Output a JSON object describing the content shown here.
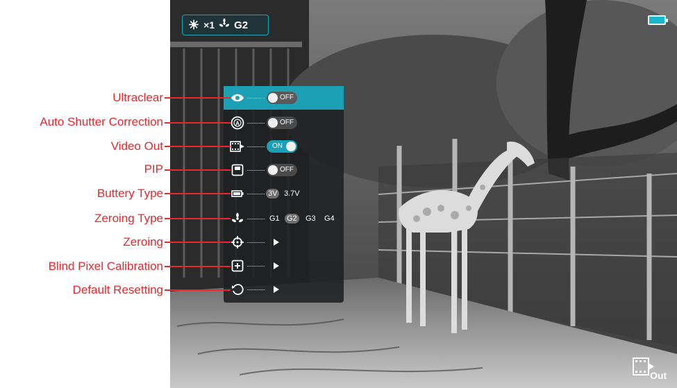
{
  "callouts": [
    {
      "label": "Ultraclear"
    },
    {
      "label": "Auto Shutter Correction"
    },
    {
      "label": "Video Out"
    },
    {
      "label": "PIP"
    },
    {
      "label": "Buttery Type"
    },
    {
      "label": "Zeroing Type"
    },
    {
      "label": "Zeroing"
    },
    {
      "label": "Blind Pixel Calibration"
    },
    {
      "label": "Default Resetting"
    }
  ],
  "status": {
    "brightness_icon": "sun-icon",
    "zoom": "×1",
    "zeroing_icon": "zeroing-fan-icon",
    "zeroing_value": "G2"
  },
  "battery": {
    "icon": "battery-icon",
    "level": 1.0,
    "color": "#18b7c9"
  },
  "menu": {
    "ultraclear": {
      "icon": "eye-icon",
      "state": "OFF"
    },
    "auto_shutter": {
      "icon": "auto-shutter-icon",
      "state": "OFF"
    },
    "video_out": {
      "icon": "video-out-icon",
      "state": "ON"
    },
    "pip": {
      "icon": "pip-icon",
      "state": "OFF"
    },
    "battery_type": {
      "icon": "battery-small-icon",
      "options": [
        "3V",
        "3.7V"
      ],
      "selected": "3V"
    },
    "zeroing_type": {
      "icon": "zeroing-fan-icon",
      "options": [
        "G1",
        "G2",
        "G3",
        "G4"
      ],
      "selected": "G2"
    },
    "zeroing": {
      "icon": "crosshair-icon"
    },
    "blind_pixel": {
      "icon": "blind-pixel-icon"
    },
    "default_reset": {
      "icon": "reset-icon"
    }
  },
  "video_out_indicator": {
    "icon": "video-out-icon",
    "label": "Out"
  },
  "colors": {
    "accent": "#1ba0b6",
    "callout": "#e8282d"
  }
}
